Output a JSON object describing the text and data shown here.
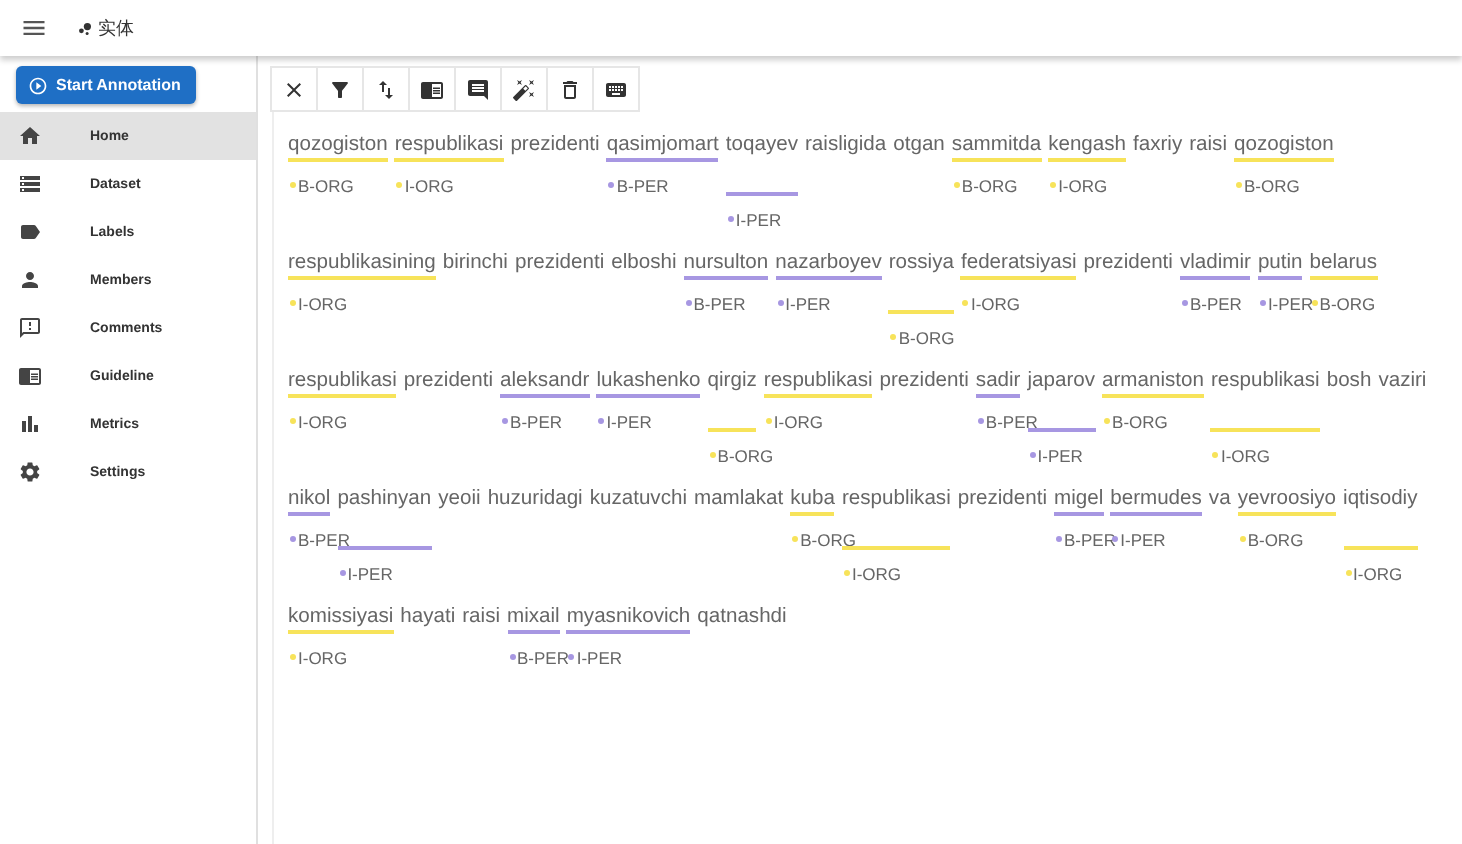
{
  "app_bar": {
    "title": "实体"
  },
  "sidebar": {
    "start_button": "Start Annotation",
    "items": [
      {
        "label": "Home",
        "selected": true
      },
      {
        "label": "Dataset",
        "selected": false
      },
      {
        "label": "Labels",
        "selected": false
      },
      {
        "label": "Members",
        "selected": false
      },
      {
        "label": "Comments",
        "selected": false
      },
      {
        "label": "Guideline",
        "selected": false
      },
      {
        "label": "Metrics",
        "selected": false
      },
      {
        "label": "Settings",
        "selected": false
      }
    ]
  },
  "lines": [
    [
      {
        "text": "qozogiston",
        "label": "B-ORG",
        "color": "#f7e35a",
        "stacked": false
      },
      {
        "text": "respublikasi",
        "label": "I-ORG",
        "color": "#f7e35a",
        "stacked": false
      },
      {
        "text": "prezidenti"
      },
      {
        "text": "qasimjomart",
        "label": "B-PER",
        "color": "#a797e2",
        "stacked": false
      },
      {
        "text": "toqayev",
        "label": "I-PER",
        "color": "#a797e2",
        "stacked": true
      },
      {
        "text": "raisligida"
      },
      {
        "text": "otgan"
      },
      {
        "text": "sammitda",
        "label": "B-ORG",
        "color": "#f7e35a",
        "stacked": false
      },
      {
        "text": "kengash",
        "label": "I-ORG",
        "color": "#f7e35a",
        "stacked": false
      },
      {
        "text": "faxriy"
      },
      {
        "text": "raisi"
      },
      {
        "text": "qozogiston",
        "label": "B-ORG",
        "color": "#f7e35a",
        "stacked": false
      }
    ],
    [
      {
        "text": "respublikasining",
        "label": "I-ORG",
        "color": "#f7e35a",
        "stacked": false
      },
      {
        "text": "birinchi"
      },
      {
        "text": "prezidenti"
      },
      {
        "text": "elboshi"
      },
      {
        "text": "nursulton",
        "label": "B-PER",
        "color": "#a797e2",
        "stacked": false
      },
      {
        "text": "nazarboyev",
        "label": "I-PER",
        "color": "#a797e2",
        "stacked": false
      },
      {
        "text": "rossiya",
        "label": "B-ORG",
        "color": "#f7e35a",
        "stacked": true
      },
      {
        "text": "federatsiyasi",
        "label": "I-ORG",
        "color": "#f7e35a",
        "stacked": false
      },
      {
        "text": "prezidenti"
      },
      {
        "text": "vladimir",
        "label": "B-PER",
        "color": "#a797e2",
        "stacked": false
      },
      {
        "text": "putin",
        "label": "I-PER",
        "color": "#a797e2",
        "stacked": false
      },
      {
        "text": "belarus",
        "label": "B-ORG",
        "color": "#f7e35a",
        "stacked": false
      }
    ],
    [
      {
        "text": "respublikasi",
        "label": "I-ORG",
        "color": "#f7e35a",
        "stacked": false
      },
      {
        "text": "prezidenti"
      },
      {
        "text": "aleksandr",
        "label": "B-PER",
        "color": "#a797e2",
        "stacked": false
      },
      {
        "text": "lukashenko",
        "label": "I-PER",
        "color": "#a797e2",
        "stacked": false
      },
      {
        "text": "qirgiz",
        "label": "B-ORG",
        "color": "#f7e35a",
        "stacked": true
      },
      {
        "text": "respublikasi",
        "label": "I-ORG",
        "color": "#f7e35a",
        "stacked": false
      },
      {
        "text": "prezidenti"
      },
      {
        "text": "sadir",
        "label": "B-PER",
        "color": "#a797e2",
        "stacked": false
      },
      {
        "text": "japarov",
        "label": "I-PER",
        "color": "#a797e2",
        "stacked": true
      },
      {
        "text": "armaniston",
        "label": "B-ORG",
        "color": "#f7e35a",
        "stacked": false
      },
      {
        "text": "respublikasi",
        "label": "I-ORG",
        "color": "#f7e35a",
        "stacked": true
      },
      {
        "text": "bosh"
      },
      {
        "text": "vaziri"
      }
    ],
    [
      {
        "text": "nikol",
        "label": "B-PER",
        "color": "#a797e2",
        "stacked": false
      },
      {
        "text": "pashinyan",
        "label": "I-PER",
        "color": "#a797e2",
        "stacked": true
      },
      {
        "text": "yeoii"
      },
      {
        "text": "huzuridagi"
      },
      {
        "text": "kuzatuvchi"
      },
      {
        "text": "mamlakat"
      },
      {
        "text": "kuba",
        "label": "B-ORG",
        "color": "#f7e35a",
        "stacked": false
      },
      {
        "text": "respublikasi",
        "label": "I-ORG",
        "color": "#f7e35a",
        "stacked": true
      },
      {
        "text": "prezidenti"
      },
      {
        "text": "migel",
        "label": "B-PER",
        "color": "#a797e2",
        "stacked": false
      },
      {
        "text": "bermudes",
        "label": "I-PER",
        "color": "#a797e2",
        "stacked": false
      },
      {
        "text": "va"
      },
      {
        "text": "yevroosiyo",
        "label": "B-ORG",
        "color": "#f7e35a",
        "stacked": false
      },
      {
        "text": "iqtisodiy",
        "label": "I-ORG",
        "color": "#f7e35a",
        "stacked": true
      }
    ],
    [
      {
        "text": "komissiyasi",
        "label": "I-ORG",
        "color": "#f7e35a",
        "stacked": false
      },
      {
        "text": "hayati"
      },
      {
        "text": "raisi"
      },
      {
        "text": "mixail",
        "label": "B-PER",
        "color": "#a797e2",
        "stacked": false
      },
      {
        "text": "myasnikovich",
        "label": "I-PER",
        "color": "#a797e2",
        "stacked": false
      },
      {
        "text": "qatnashdi"
      }
    ]
  ]
}
